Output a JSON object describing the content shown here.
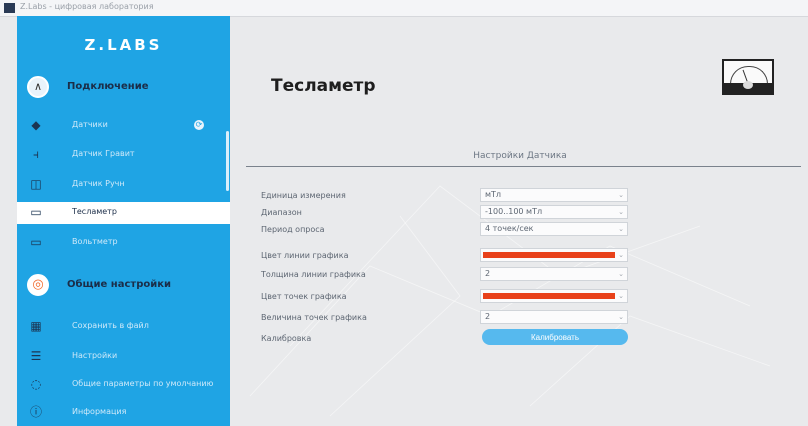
{
  "window": {
    "title": "Z.Labs - цифровая лаборатория"
  },
  "sidebar": {
    "brand": "Z.LABS",
    "sections": [
      {
        "label": "Подключение",
        "icon": "connection-icon"
      },
      {
        "label": "Общие настройки",
        "icon": "settings-icon"
      }
    ],
    "items": [
      {
        "label": "Датчики",
        "icon": "sensor-icon"
      },
      {
        "label": "Датчик Гравит",
        "icon": "thermometer-icon"
      },
      {
        "label": "Датчик Ручн",
        "icon": "chart-icon"
      },
      {
        "label": "Тесламетр",
        "icon": "teslameter-icon",
        "active": true
      },
      {
        "label": "Вольтметр",
        "icon": "image-icon"
      },
      {
        "label": "Сохранить в файл",
        "icon": "save-icon"
      },
      {
        "label": "Настройки",
        "icon": "list-icon"
      },
      {
        "label": "Общие параметры по умолчанию",
        "icon": "defaults-icon"
      },
      {
        "label": "Информация",
        "icon": "info-icon"
      }
    ]
  },
  "main": {
    "title": "Тесламетр",
    "tab": "Настройки Датчика",
    "settings": [
      {
        "label": "Единица измерения",
        "value": "мТл",
        "type": "select"
      },
      {
        "label": "Диапазон",
        "value": "-100..100 мТл",
        "type": "select"
      },
      {
        "label": "Период опроса",
        "value": "4 точек/сек",
        "type": "select"
      },
      {
        "label": "Цвет линии графика",
        "value": "",
        "type": "color",
        "color": "#e8411a"
      },
      {
        "label": "Толщина линии графика",
        "value": "2",
        "type": "select"
      },
      {
        "label": "Цвет точек графика",
        "value": "",
        "type": "color",
        "color": "#e8411a"
      },
      {
        "label": "Величина точек графика",
        "value": "2",
        "type": "select"
      },
      {
        "label": "Калибровка",
        "value": "Калибровать",
        "type": "button"
      }
    ]
  },
  "colors": {
    "accent": "#1fa4e4",
    "button": "#56b9ee",
    "swatch": "#e8411a"
  }
}
